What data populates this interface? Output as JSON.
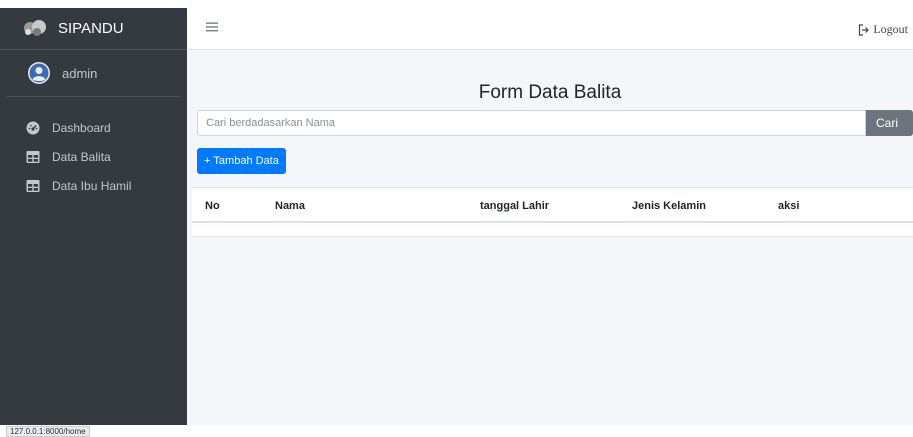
{
  "brand": {
    "name": "SIPANDU"
  },
  "user": {
    "name": "admin"
  },
  "sidebar": {
    "items": [
      {
        "label": "Dashboard",
        "icon": "dashboard-icon"
      },
      {
        "label": "Data Balita",
        "icon": "table-icon"
      },
      {
        "label": "Data Ibu Hamil",
        "icon": "table-icon"
      }
    ]
  },
  "navbar": {
    "logout_label": "Logout"
  },
  "main": {
    "title": "Form Data Balita",
    "search": {
      "placeholder": "Cari berdadasarkan Nama",
      "value": "",
      "button_label": "Cari"
    },
    "add_button_label": "+ Tambah Data",
    "table": {
      "columns": [
        "No",
        "Nama",
        "tanggal Lahir",
        "Jenis Kelamin",
        "aksi"
      ],
      "rows": []
    }
  },
  "status_bar": {
    "url": "127.0.0.1:8000/home"
  },
  "colors": {
    "sidebar_bg": "#343a40",
    "primary": "#007bff",
    "secondary": "#6c757d",
    "content_bg": "#f4f6f9"
  }
}
